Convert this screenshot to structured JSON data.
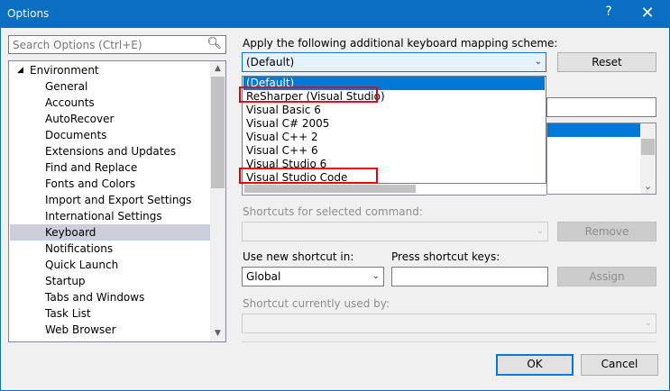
{
  "window": {
    "title": "Options",
    "help_glyph": "?",
    "close_glyph": "✕"
  },
  "search": {
    "placeholder": "Search Options (Ctrl+E)"
  },
  "tree": {
    "items": [
      {
        "label": "Environment",
        "root": true
      },
      {
        "label": "General"
      },
      {
        "label": "Accounts"
      },
      {
        "label": "AutoRecover"
      },
      {
        "label": "Documents"
      },
      {
        "label": "Extensions and Updates"
      },
      {
        "label": "Find and Replace"
      },
      {
        "label": "Fonts and Colors"
      },
      {
        "label": "Import and Export Settings"
      },
      {
        "label": "International Settings"
      },
      {
        "label": "Keyboard",
        "selected": true
      },
      {
        "label": "Notifications"
      },
      {
        "label": "Quick Launch"
      },
      {
        "label": "Startup"
      },
      {
        "label": "Tabs and Windows"
      },
      {
        "label": "Task List"
      },
      {
        "label": "Web Browser"
      }
    ]
  },
  "mapping": {
    "label": "Apply the following additional keyboard mapping scheme:",
    "selected": "(Default)",
    "reset_label": "Reset",
    "options": [
      "(Default)",
      "ReSharper (Visual Studio)",
      "Visual Basic 6",
      "Visual C# 2005",
      "Visual C++ 2",
      "Visual C++ 6",
      "Visual Studio 6",
      "Visual Studio Code"
    ],
    "highlighted_index": 0
  },
  "shortcuts_for_command": {
    "label": "Shortcuts for selected command:",
    "remove_label": "Remove"
  },
  "use_new_shortcut": {
    "label": "Use new shortcut in:",
    "value": "Global"
  },
  "press_keys": {
    "label": "Press shortcut keys:",
    "assign_label": "Assign"
  },
  "currently_used_by": {
    "label": "Shortcut currently used by:"
  },
  "footer": {
    "ok_label": "OK",
    "cancel_label": "Cancel"
  },
  "colors": {
    "accent": "#0078d7",
    "titlebar": "#0a6fc2",
    "highlight_box": "#e60012",
    "selected_tree": "#cccedb"
  }
}
